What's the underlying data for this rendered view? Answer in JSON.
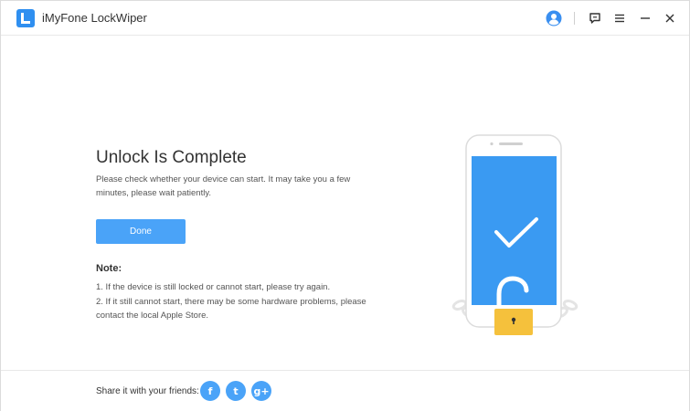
{
  "app": {
    "title": "iMyFone LockWiper",
    "accent_color": "#4aa3f8",
    "logo_color": "#2f8ff0",
    "toolbar_icons": [
      "user-icon",
      "feedback-icon",
      "menu-icon",
      "minimize-icon",
      "close-icon"
    ]
  },
  "main": {
    "heading": "Unlock Is Complete",
    "description": "Please check whether your device can start. It may take you a few minutes, please wait patiently.",
    "done_button": "Done",
    "note": {
      "title": "Note:",
      "items": [
        "1. If the device is still locked or cannot start, please try again.",
        "2. If it still cannot start, there may be some hardware problems, please contact the local Apple Store."
      ]
    },
    "illustration": {
      "icons": [
        "phone-icon",
        "checkmark-icon",
        "open-padlock-icon",
        "chain-icon"
      ],
      "screen_color": "#3a9af2",
      "lock_color": "#f5c13c"
    }
  },
  "footer": {
    "share_label": "Share it with your friends:",
    "social": [
      {
        "icon": "facebook-icon",
        "glyph": "f"
      },
      {
        "icon": "twitter-icon",
        "glyph": "t"
      },
      {
        "icon": "google-plus-icon",
        "glyph": "g+"
      }
    ]
  }
}
